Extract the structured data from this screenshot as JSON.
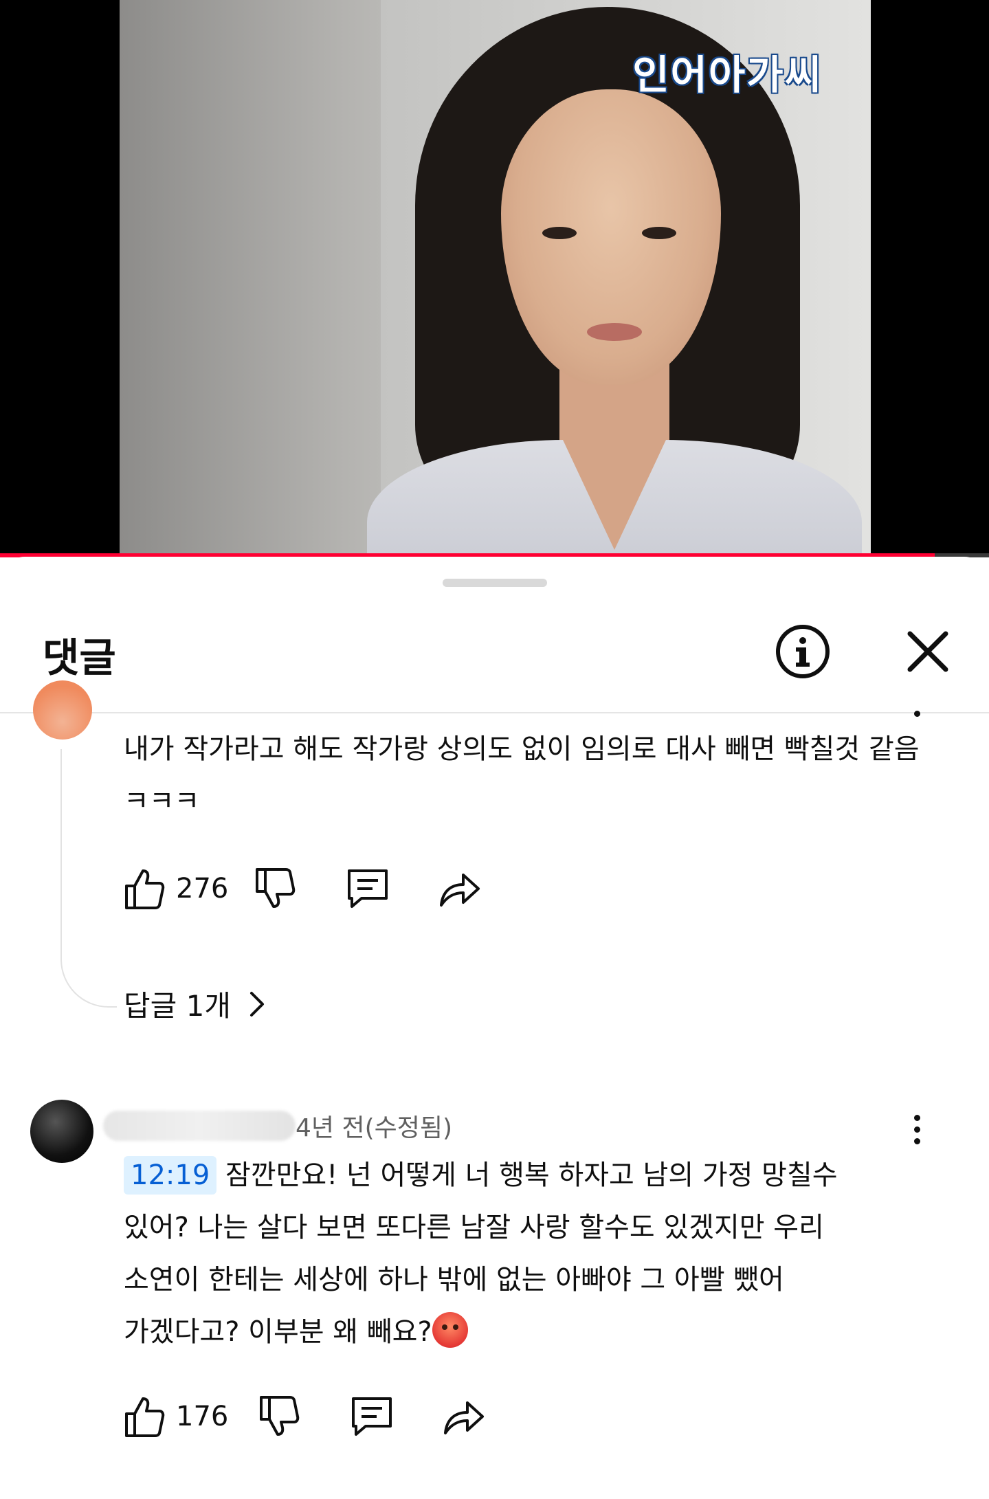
{
  "video": {
    "watermark": "인어아가씨",
    "progress": 0.945
  },
  "panel": {
    "title": "댓글"
  },
  "comments": [
    {
      "text": "내가 작가라고 해도 작가랑 상의도 없이 임의로 대사 빼면 빡칠것 같음 ㅋㅋㅋ",
      "likes": "276",
      "replies_label": "답글 1개"
    },
    {
      "time": "4년 전(수정됨)",
      "timestamp": "12:19",
      "text_line1": "잠깐만요! 넌 어떻게 너 행복 하자고 남의 가정 망칠수",
      "text_line2": "있어? 나는 살다 보면 또다른 남잘 사랑 할수도 있겠지만 우리",
      "text_line3": "소연이 한테는 세상에 하나 밖에 없는 아빠야 그 아빨 뺐어",
      "text_line4": "가겠다고? 이부분 왜 빼요?",
      "likes": "176"
    }
  ],
  "colors": {
    "progress_red": "#ff0033",
    "timestamp_blue": "#065fd4",
    "timestamp_bg": "#def1ff"
  }
}
